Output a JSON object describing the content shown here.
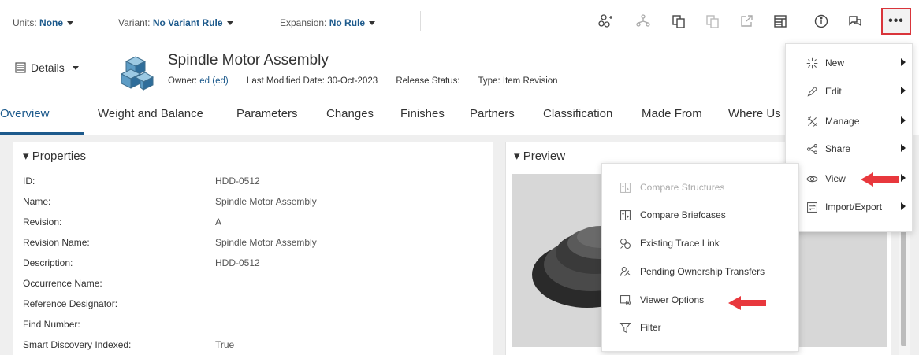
{
  "toolbar": {
    "units_label": "Units:",
    "units_value": "None",
    "variant_label": "Variant:",
    "variant_value": "No Variant Rule",
    "expansion_label": "Expansion:",
    "expansion_value": "No Rule",
    "more_label": "•••"
  },
  "header": {
    "details_label": "Details",
    "title": "Spindle Motor Assembly",
    "owner_label": "Owner:",
    "owner_value": "ed (ed)",
    "modified_label": "Last Modified Date:",
    "modified_value": "30-Oct-2023",
    "release_label": "Release Status:",
    "type_label": "Type:",
    "type_value": "Item Revision"
  },
  "tabs": [
    "Overview",
    "Weight and Balance",
    "Parameters",
    "Changes",
    "Finishes",
    "Partners",
    "Classification",
    "Made From",
    "Where Us"
  ],
  "properties": {
    "title": "▾ Properties",
    "rows": [
      {
        "label": "ID:",
        "value": "HDD-0512"
      },
      {
        "label": "Name:",
        "value": "Spindle Motor Assembly"
      },
      {
        "label": "Revision:",
        "value": "A"
      },
      {
        "label": "Revision Name:",
        "value": "Spindle Motor Assembly"
      },
      {
        "label": "Description:",
        "value": "HDD-0512"
      },
      {
        "label": "Occurrence Name:",
        "value": ""
      },
      {
        "label": "Reference Designator:",
        "value": ""
      },
      {
        "label": "Find Number:",
        "value": ""
      },
      {
        "label": "Smart Discovery Indexed:",
        "value": "True"
      }
    ]
  },
  "preview": {
    "title": "▾ Preview"
  },
  "main_menu": {
    "items": [
      {
        "label": "New",
        "icon": "sparkle-icon"
      },
      {
        "label": "Edit",
        "icon": "pencil-icon"
      },
      {
        "label": "Manage",
        "icon": "tools-icon"
      },
      {
        "label": "Share",
        "icon": "share-icon"
      },
      {
        "label": "View",
        "icon": "eye-icon"
      },
      {
        "label": "Import/Export",
        "icon": "import-export-icon"
      }
    ]
  },
  "view_menu": {
    "items": [
      {
        "label": "Compare Structures",
        "icon": "compare-structures-icon",
        "disabled": true
      },
      {
        "label": "Compare Briefcases",
        "icon": "compare-briefcases-icon"
      },
      {
        "label": "Existing Trace Link",
        "icon": "trace-link-icon"
      },
      {
        "label": "Pending Ownership Transfers",
        "icon": "ownership-transfer-icon"
      },
      {
        "label": "Viewer Options",
        "icon": "viewer-options-icon"
      },
      {
        "label": "Filter",
        "icon": "filter-icon"
      }
    ]
  },
  "colors": {
    "accent": "#1d5a8c",
    "highlight": "#d9353b",
    "arrow": "#e8383d"
  }
}
